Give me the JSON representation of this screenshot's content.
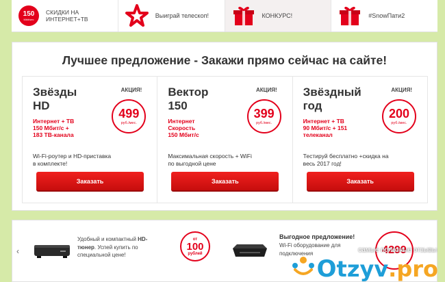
{
  "tabs": [
    {
      "badge_num": "150",
      "badge_sub": "Mbit/sec",
      "label_line1": "Скидки на",
      "label_line2": "интернет+ТВ"
    },
    {
      "label": "Выиграй телескоп!"
    },
    {
      "label": "КОНКУРС!"
    },
    {
      "label": "#SnowПати2"
    }
  ],
  "headline": "Лучшее предложение - Закажи прямо сейчас на сайте!",
  "cards": [
    {
      "title_l1": "Звёзды",
      "title_l2": "HD",
      "promo": "АКЦИЯ!",
      "price": "499",
      "unit": "руб./мес.",
      "feat_l1": "Интернет + ТВ",
      "feat_l2": "150 Мбит/с +",
      "feat_l3": "183 ТВ-канала",
      "desc_l1": "Wi-Fi-роутер и HD-приставка",
      "desc_l2": "в комплекте!",
      "button": "Заказать"
    },
    {
      "title_l1": "Вектор",
      "title_l2": "150",
      "promo": "АКЦИЯ!",
      "price": "399",
      "unit": "руб./мес.",
      "feat_l1": "Интернет",
      "feat_l2": "Скорость",
      "feat_l3": "150 Мбит/с",
      "desc_l1": "Максимальная скорость + WiFi",
      "desc_l2": "по выгодной цене",
      "button": "Заказать"
    },
    {
      "title_l1": "Звёздный",
      "title_l2": "год",
      "promo": "АКЦИЯ!",
      "price": "200",
      "unit": "руб./мес.",
      "feat_l1": "Интернет + ТВ",
      "feat_l2": "90 Мбит/с + 151",
      "feat_l3": "телеканал",
      "desc_l1": "Тестируй бесплатно +скидка на",
      "desc_l2": "весь 2017 год!",
      "button": "Заказать"
    }
  ],
  "carousel": {
    "arrow": "‹",
    "promo1_l1_a": "Удобный и компактный ",
    "promo1_l1_b": "HD-",
    "promo1_l2_b": "тюнер",
    "promo1_l2_a": ". Успей купить по",
    "promo1_l3": "специальной цене!",
    "circle1_top": "от",
    "circle1_num": "100",
    "circle1_bottom": "рублей",
    "promo2_title": "Выгодное предложение!",
    "promo2_l2": "Wi-Fi оборудование для",
    "promo2_l3": "подключения",
    "price2": "4299"
  },
  "watermark": {
    "slogan": "самые полезные отзывы",
    "logo_o": "O",
    "logo_rest": "tzyv",
    "logo_tld": ".pro"
  }
}
